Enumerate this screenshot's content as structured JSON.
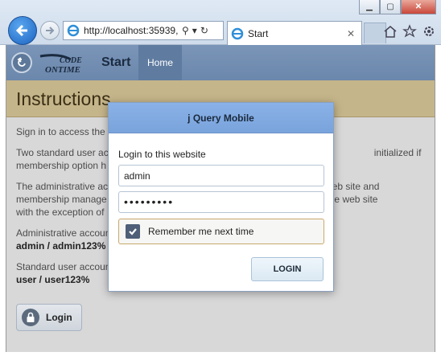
{
  "browser": {
    "address": "http://localhost:35939,",
    "tab_title": "Start"
  },
  "app": {
    "logo_top": "CODE",
    "logo_bottom": "ONTIME",
    "title": "Start",
    "nav_home": "Home",
    "section_title": "Instructions"
  },
  "content": {
    "p1": "Sign in to access the p",
    "p2": "Two standard user ac                                                               initialized if membership option h",
    "p2a": "Two standard user ac",
    "p2b": "initialized if",
    "p2c": "membership option h",
    "p3a": "The administrative ac",
    "p3b": "web site and",
    "p3c": "membership manage",
    "p3d": "areas of the web site",
    "p3e": "with the exception of",
    "admin_label": "Administrative accoun",
    "admin_creds": "admin / admin123%",
    "user_label": "Standard user accoun",
    "user_creds": "user / user123%",
    "login_button": "Login"
  },
  "modal": {
    "header": "j Query Mobile",
    "label": "Login to this website",
    "username": "admin",
    "password": "•••••••••",
    "remember": "Remember me next time",
    "remember_checked": true,
    "submit": "LOGIN"
  }
}
